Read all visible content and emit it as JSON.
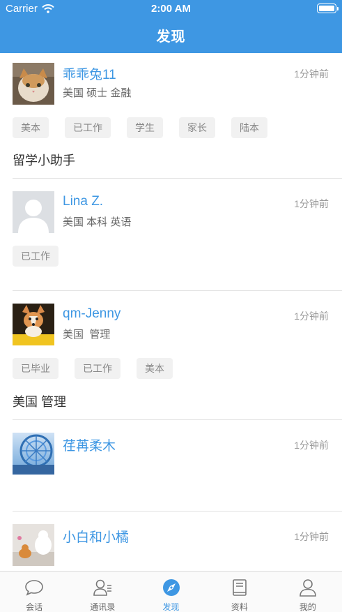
{
  "status_bar": {
    "carrier": "Carrier",
    "time": "2:00 AM"
  },
  "nav": {
    "title": "发现"
  },
  "colors": {
    "brand": "#3e97e3",
    "tag_bg": "#f1f1f1",
    "divider": "#e2e2e2"
  },
  "feed": [
    {
      "name": "乖乖兔11",
      "time": "1分钟前",
      "meta": "美国 硕士 金融",
      "tags": [
        "美本",
        "已工作",
        "学生",
        "家长",
        "陆本"
      ],
      "desc": "留学小助手",
      "avatar_icon": "cat-photo"
    },
    {
      "name": "Lina Z.",
      "time": "1分钟前",
      "meta": "美国 本科 英语",
      "tags": [
        "已工作"
      ],
      "desc": "",
      "avatar_icon": "default-person"
    },
    {
      "name": "qm-Jenny",
      "time": "1分钟前",
      "meta": "美国  管理",
      "tags": [
        "已毕业",
        "已工作",
        "美本"
      ],
      "desc": "美国 管理",
      "avatar_icon": "corgi-photo"
    },
    {
      "name": "荏苒柔木",
      "time": "1分钟前",
      "meta": "",
      "tags": [],
      "desc": "",
      "avatar_icon": "ferris-wheel-photo"
    },
    {
      "name": "小白和小橘",
      "time": "1分钟前",
      "meta": "",
      "tags": [],
      "desc": "",
      "avatar_icon": "cats-photo"
    }
  ],
  "tabbar": [
    {
      "label": "会话",
      "icon": "chat-bubble-icon"
    },
    {
      "label": "通讯录",
      "icon": "contacts-icon"
    },
    {
      "label": "发现",
      "icon": "compass-icon",
      "active": true
    },
    {
      "label": "资料",
      "icon": "book-icon"
    },
    {
      "label": "我的",
      "icon": "user-icon"
    }
  ]
}
